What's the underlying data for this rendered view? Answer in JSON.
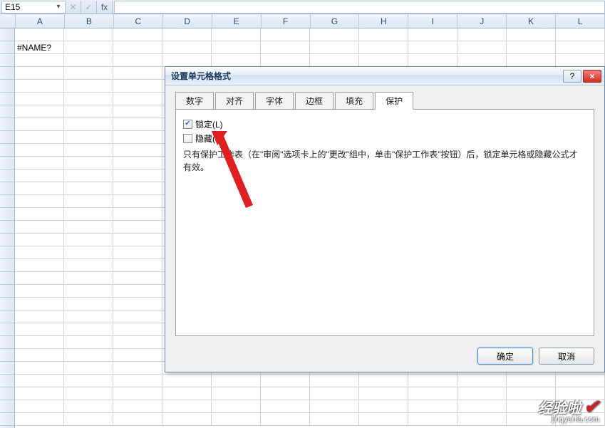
{
  "formula_bar": {
    "cell_ref": "E15",
    "fx_label": "fx"
  },
  "columns": [
    "A",
    "B",
    "C",
    "D",
    "E",
    "F",
    "G",
    "H",
    "I",
    "J",
    "K",
    "L"
  ],
  "sheet": {
    "a2": "#NAME?"
  },
  "dialog": {
    "title": "设置单元格格式",
    "help_label": "?",
    "close_label": "×",
    "tabs": {
      "number": "数字",
      "align": "对齐",
      "font": "字体",
      "border": "边框",
      "fill": "填充",
      "protect": "保护"
    },
    "protect": {
      "lock": "锁定(L)",
      "hide": "隐藏(I)",
      "desc1": "只有保护工作表（在\"审阅\"选项卡上的\"更改\"组中，单击\"保护工作表\"按钮）后，锁定单元格或隐藏公式才",
      "desc2": "有效。"
    },
    "buttons": {
      "ok": "确定",
      "cancel": "取消"
    }
  },
  "watermark": {
    "main": "经验啦",
    "sub": "jingyanla.com"
  }
}
